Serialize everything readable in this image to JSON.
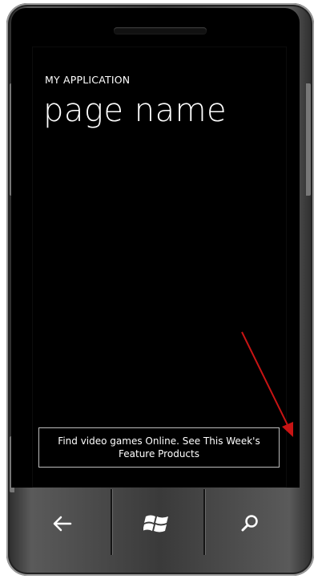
{
  "app": {
    "title": "MY APPLICATION",
    "page_name": "page name"
  },
  "ad": {
    "text": "Find video games Online. See This Week's Feature Products"
  },
  "nav": {
    "back_icon": "back-arrow-icon",
    "start_icon": "windows-logo-icon",
    "search_icon": "search-icon"
  },
  "colors": {
    "screen_bg": "#000000",
    "text": "#ffffff",
    "annotation_arrow": "#c81414"
  }
}
